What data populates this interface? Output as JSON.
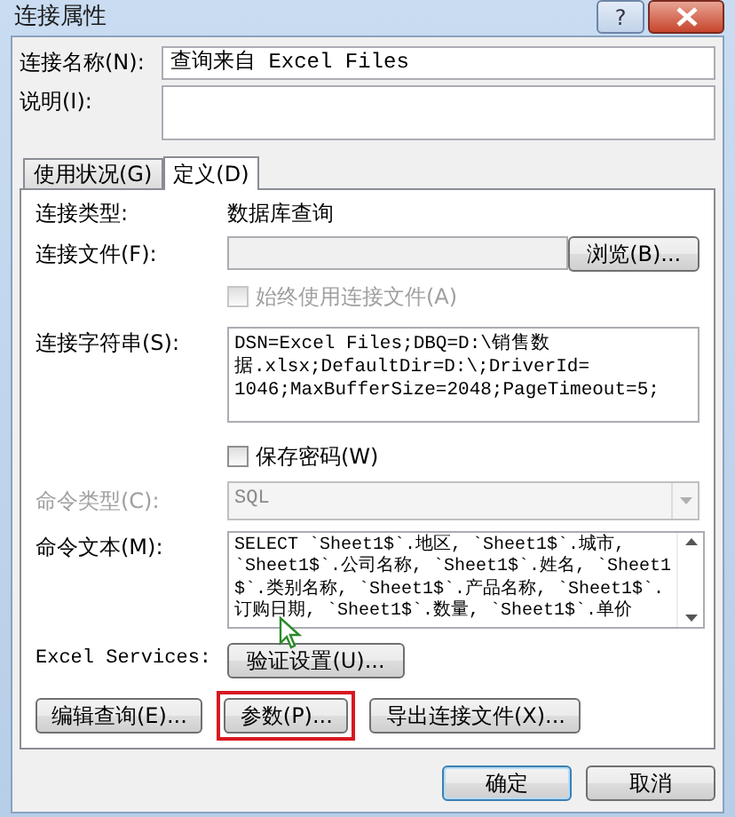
{
  "window": {
    "title": "连接属性",
    "help_button": "?"
  },
  "connection_name": {
    "label": "连接名称(N):",
    "value": "查询来自 Excel Files"
  },
  "description": {
    "label": "说明(I):"
  },
  "tabs": [
    {
      "label": "使用状况(G)",
      "selected": false
    },
    {
      "label": "定义(D)",
      "selected": true
    }
  ],
  "connection_type": {
    "label": "连接类型:",
    "value": "数据库查询"
  },
  "connection_file": {
    "label": "连接文件(F):",
    "disabled": true,
    "browse_button": "浏览(B)..."
  },
  "always_use_file": {
    "label": "始终使用连接文件(A)",
    "checked": false,
    "disabled": true
  },
  "connection_string": {
    "label": "连接字符串(S):",
    "lines": [
      "DSN=Excel Files;DBQ=D:\\销售数",
      "据.xlsx;DefaultDir=D:\\;DriverId=",
      "1046;MaxBufferSize=2048;PageTimeout=5;"
    ]
  },
  "save_password": {
    "label": "保存密码(W)",
    "checked": false,
    "disabled": false
  },
  "command_type": {
    "label": "命令类型(C):",
    "value": "SQL",
    "disabled": true
  },
  "command_text": {
    "label": "命令文本(M):",
    "lines": [
      "SELECT `Sheet1$`.地区, `Sheet1$`.城市,",
      "`Sheet1$`.公司名称, `Sheet1$`.姓名, `Sheet1",
      "$`.类别名称, `Sheet1$`.产品名称, `Sheet1$`.",
      "订购日期, `Sheet1$`.数量, `Sheet1$`.单价"
    ]
  },
  "excel_services": {
    "label": "Excel Services:",
    "button": "验证设置(U)..."
  },
  "action_buttons": [
    {
      "label": "编辑查询(E)...",
      "highlighted": false
    },
    {
      "label": "参数(P)...",
      "highlighted": true
    },
    {
      "label": "导出连接文件(X)...",
      "highlighted": false
    }
  ],
  "dialog_buttons": [
    {
      "label": "确定",
      "default": true
    },
    {
      "label": "取消",
      "default": false
    }
  ]
}
